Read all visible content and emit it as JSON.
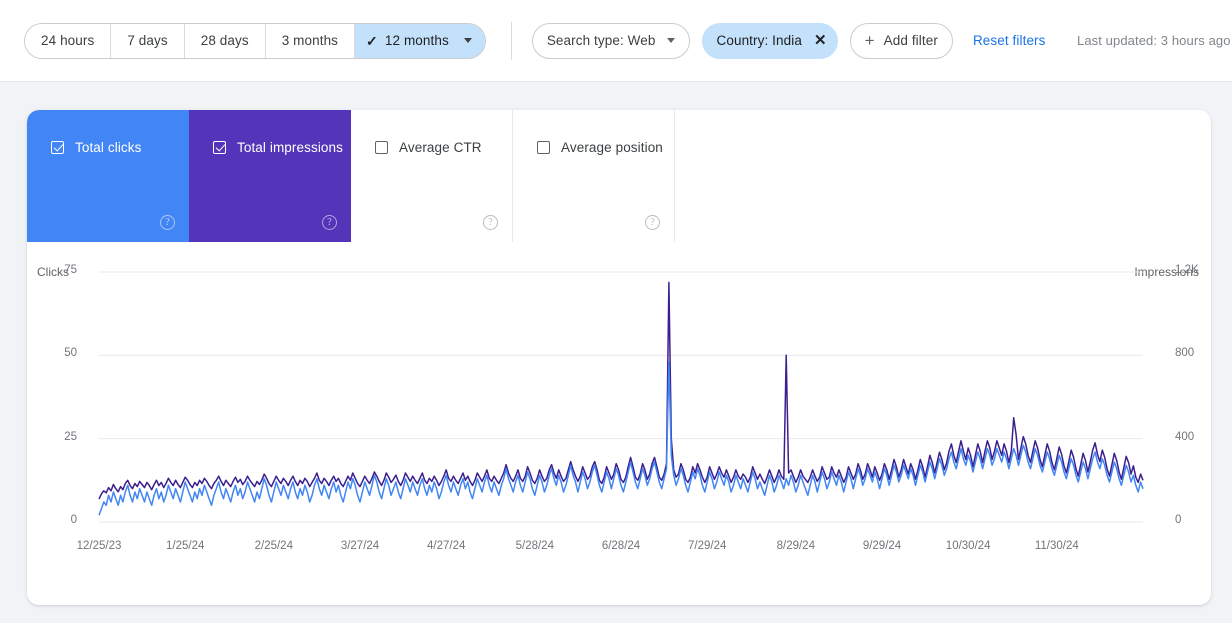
{
  "toolbar": {
    "date_ranges": [
      {
        "label": "24 hours",
        "active": false
      },
      {
        "label": "7 days",
        "active": false
      },
      {
        "label": "28 days",
        "active": false
      },
      {
        "label": "3 months",
        "active": false
      },
      {
        "label": "12 months",
        "active": true
      }
    ],
    "search_type_chip": "Search type: Web",
    "country_chip": "Country: India",
    "add_filter": "Add filter",
    "reset_filters": "Reset filters",
    "last_updated": "Last updated: 3 hours ago",
    "icons": {
      "check": "✓",
      "close": "✕",
      "plus": "+"
    }
  },
  "metrics": [
    {
      "label": "Total clicks",
      "value": "",
      "selected": true,
      "color": "#4285f4",
      "help": "?"
    },
    {
      "label": "Total impressions",
      "value": "",
      "selected": true,
      "color": "#5434b8",
      "help": "?"
    },
    {
      "label": "Average CTR",
      "value": "",
      "selected": false,
      "color": "#ffffff",
      "help": "?"
    },
    {
      "label": "Average position",
      "value": "",
      "selected": false,
      "color": "#ffffff",
      "help": "?"
    }
  ],
  "chart_data": {
    "type": "line",
    "title": "",
    "xlabel": "",
    "ylabel": "Clicks",
    "y2label": "Impressions",
    "grid": true,
    "legend": "none",
    "ylim": [
      0,
      75
    ],
    "y2lim": [
      0,
      1200
    ],
    "yticks": [
      "0",
      "25",
      "50",
      "75"
    ],
    "y2ticks": [
      "0",
      "400",
      "800",
      "1.2K"
    ],
    "xticks": [
      "12/25/23",
      "1/25/24",
      "2/25/24",
      "3/27/24",
      "4/27/24",
      "5/28/24",
      "6/28/24",
      "7/29/24",
      "8/29/24",
      "9/29/24",
      "10/30/24",
      "11/30/24"
    ],
    "series": [
      {
        "name": "Total clicks",
        "color": "#4285f4",
        "axis": "left",
        "values": [
          2,
          4,
          6,
          5,
          8,
          6,
          9,
          7,
          5,
          8,
          6,
          9,
          11,
          8,
          6,
          9,
          7,
          10,
          8,
          6,
          9,
          7,
          5,
          8,
          10,
          7,
          9,
          6,
          8,
          11,
          9,
          7,
          10,
          8,
          6,
          9,
          12,
          10,
          8,
          6,
          9,
          7,
          10,
          8,
          11,
          9,
          7,
          5,
          8,
          10,
          12,
          9,
          7,
          10,
          8,
          6,
          9,
          11,
          8,
          10,
          7,
          9,
          12,
          10,
          8,
          6,
          9,
          7,
          10,
          13,
          11,
          8,
          6,
          9,
          12,
          10,
          8,
          11,
          9,
          7,
          10,
          12,
          9,
          7,
          10,
          8,
          11,
          9,
          6,
          8,
          11,
          13,
          10,
          8,
          11,
          9,
          7,
          10,
          12,
          9,
          11,
          8,
          6,
          9,
          12,
          10,
          13,
          11,
          8,
          6,
          9,
          12,
          10,
          8,
          11,
          14,
          12,
          9,
          7,
          10,
          13,
          11,
          8,
          10,
          12,
          9,
          7,
          10,
          13,
          11,
          9,
          12,
          10,
          8,
          11,
          13,
          10,
          8,
          11,
          9,
          12,
          10,
          7,
          9,
          12,
          14,
          11,
          9,
          12,
          10,
          8,
          11,
          13,
          10,
          12,
          9,
          7,
          10,
          13,
          11,
          9,
          12,
          14,
          11,
          9,
          12,
          10,
          8,
          11,
          13,
          16,
          13,
          11,
          9,
          12,
          14,
          11,
          9,
          12,
          15,
          13,
          10,
          8,
          11,
          14,
          12,
          9,
          11,
          14,
          16,
          13,
          11,
          14,
          12,
          9,
          11,
          14,
          17,
          14,
          12,
          9,
          12,
          15,
          13,
          10,
          12,
          15,
          17,
          14,
          11,
          9,
          12,
          15,
          13,
          10,
          13,
          16,
          14,
          11,
          9,
          12,
          15,
          18,
          15,
          12,
          10,
          13,
          16,
          14,
          11,
          13,
          16,
          18,
          15,
          12,
          10,
          13,
          16,
          48,
          20,
          14,
          11,
          13,
          16,
          14,
          11,
          9,
          12,
          15,
          13,
          16,
          14,
          11,
          9,
          12,
          15,
          13,
          10,
          12,
          15,
          13,
          11,
          14,
          12,
          9,
          11,
          14,
          12,
          10,
          13,
          11,
          9,
          12,
          15,
          13,
          10,
          12,
          10,
          8,
          11,
          14,
          12,
          9,
          11,
          14,
          12,
          10,
          13,
          11,
          14,
          12,
          9,
          11,
          14,
          12,
          10,
          8,
          11,
          14,
          12,
          9,
          12,
          15,
          13,
          10,
          12,
          15,
          13,
          11,
          14,
          12,
          9,
          12,
          15,
          13,
          10,
          13,
          16,
          14,
          11,
          13,
          16,
          14,
          12,
          15,
          13,
          10,
          13,
          16,
          14,
          11,
          14,
          17,
          15,
          12,
          14,
          17,
          15,
          13,
          16,
          14,
          11,
          14,
          17,
          15,
          12,
          15,
          18,
          16,
          13,
          16,
          19,
          17,
          14,
          16,
          19,
          21,
          18,
          16,
          19,
          22,
          19,
          17,
          20,
          18,
          15,
          18,
          21,
          19,
          16,
          19,
          22,
          20,
          17,
          19,
          22,
          20,
          18,
          21,
          19,
          16,
          19,
          22,
          20,
          17,
          20,
          23,
          21,
          18,
          16,
          19,
          22,
          20,
          17,
          15,
          18,
          21,
          19,
          16,
          14,
          17,
          20,
          18,
          15,
          13,
          16,
          19,
          17,
          14,
          12,
          15,
          18,
          16,
          13,
          16,
          19,
          21,
          18,
          16,
          19,
          17,
          14,
          12,
          15,
          18,
          16,
          13,
          11,
          14,
          17,
          15,
          12,
          14,
          11,
          9,
          12,
          10
        ]
      },
      {
        "name": "Total impressions",
        "color": "#3b1f8f",
        "axis": "right",
        "values": [
          110,
          135,
          150,
          140,
          165,
          150,
          180,
          160,
          145,
          170,
          155,
          185,
          200,
          175,
          160,
          185,
          170,
          195,
          180,
          165,
          190,
          175,
          155,
          180,
          200,
          175,
          190,
          165,
          185,
          210,
          190,
          175,
          200,
          180,
          165,
          190,
          215,
          200,
          180,
          165,
          190,
          175,
          200,
          185,
          210,
          195,
          175,
          160,
          185,
          200,
          220,
          195,
          175,
          200,
          185,
          170,
          195,
          215,
          190,
          205,
          180,
          195,
          220,
          200,
          185,
          170,
          195,
          180,
          200,
          230,
          210,
          185,
          170,
          195,
          220,
          200,
          185,
          210,
          195,
          175,
          200,
          220,
          195,
          175,
          200,
          185,
          210,
          195,
          170,
          190,
          210,
          235,
          200,
          185,
          210,
          195,
          175,
          200,
          220,
          195,
          210,
          185,
          170,
          195,
          220,
          200,
          235,
          210,
          185,
          170,
          195,
          220,
          200,
          185,
          210,
          240,
          220,
          195,
          175,
          200,
          235,
          215,
          190,
          205,
          225,
          195,
          175,
          200,
          235,
          215,
          195,
          220,
          200,
          185,
          210,
          235,
          200,
          185,
          210,
          195,
          220,
          200,
          175,
          195,
          220,
          250,
          210,
          195,
          220,
          200,
          185,
          210,
          235,
          200,
          220,
          195,
          175,
          200,
          235,
          215,
          195,
          220,
          250,
          210,
          195,
          220,
          200,
          185,
          210,
          235,
          275,
          235,
          210,
          195,
          220,
          250,
          210,
          195,
          220,
          265,
          235,
          200,
          185,
          210,
          250,
          220,
          195,
          210,
          250,
          275,
          235,
          210,
          250,
          220,
          195,
          210,
          250,
          290,
          250,
          220,
          195,
          220,
          265,
          235,
          205,
          220,
          265,
          290,
          250,
          200,
          185,
          215,
          265,
          235,
          205,
          230,
          280,
          250,
          205,
          190,
          215,
          265,
          310,
          265,
          215,
          200,
          230,
          280,
          250,
          205,
          230,
          280,
          310,
          265,
          215,
          200,
          230,
          280,
          1150,
          400,
          250,
          215,
          230,
          280,
          250,
          205,
          190,
          215,
          265,
          235,
          280,
          250,
          215,
          190,
          215,
          265,
          235,
          205,
          230,
          265,
          235,
          215,
          250,
          220,
          190,
          215,
          250,
          220,
          205,
          230,
          215,
          190,
          215,
          265,
          235,
          205,
          230,
          205,
          185,
          215,
          250,
          220,
          190,
          215,
          250,
          220,
          205,
          800,
          235,
          250,
          220,
          190,
          215,
          250,
          220,
          205,
          190,
          215,
          250,
          220,
          195,
          215,
          265,
          235,
          205,
          215,
          265,
          235,
          215,
          250,
          220,
          190,
          215,
          265,
          235,
          205,
          230,
          280,
          250,
          205,
          230,
          280,
          250,
          215,
          265,
          235,
          200,
          230,
          280,
          250,
          205,
          250,
          300,
          265,
          215,
          250,
          300,
          265,
          230,
          280,
          250,
          205,
          250,
          300,
          265,
          215,
          265,
          320,
          285,
          235,
          285,
          335,
          300,
          250,
          285,
          340,
          375,
          320,
          285,
          340,
          390,
          340,
          300,
          355,
          320,
          265,
          320,
          375,
          340,
          285,
          340,
          390,
          355,
          300,
          340,
          390,
          355,
          320,
          375,
          340,
          285,
          340,
          500,
          420,
          300,
          355,
          410,
          375,
          320,
          285,
          340,
          390,
          355,
          300,
          265,
          320,
          375,
          340,
          285,
          250,
          305,
          360,
          325,
          270,
          235,
          290,
          345,
          310,
          255,
          220,
          275,
          330,
          295,
          240,
          290,
          345,
          380,
          325,
          290,
          345,
          310,
          255,
          220,
          275,
          330,
          295,
          240,
          205,
          260,
          315,
          285,
          230,
          270,
          215,
          190,
          230,
          200
        ]
      }
    ]
  }
}
